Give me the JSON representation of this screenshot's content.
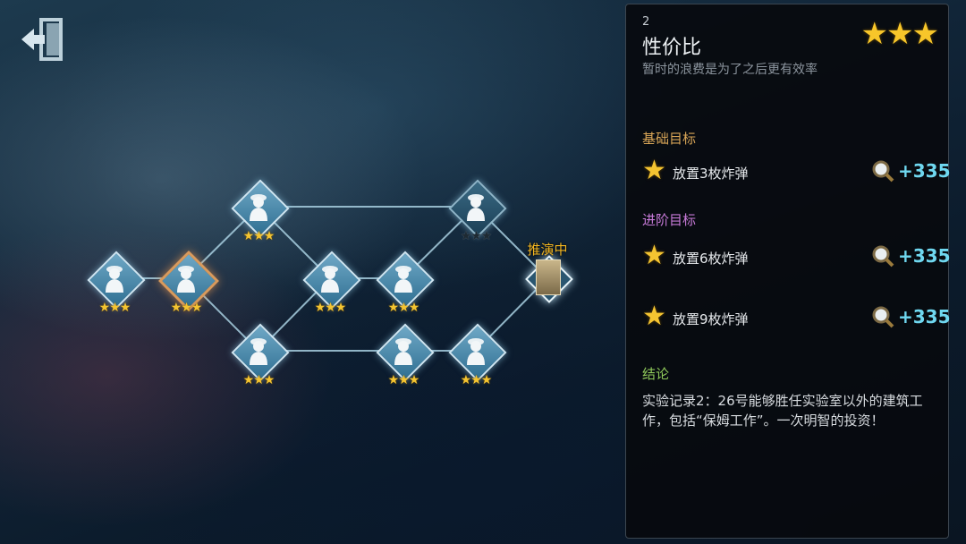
{
  "top_right_faint": "...",
  "current_node": {
    "label": "推演中"
  },
  "map": {
    "nodes": [
      {
        "id": "n1",
        "stars": 3,
        "selected": false,
        "dark": false
      },
      {
        "id": "n2",
        "stars": 3,
        "selected": true,
        "dark": false
      },
      {
        "id": "n3",
        "stars": 3,
        "selected": false,
        "dark": false
      },
      {
        "id": "n4",
        "stars": 3,
        "selected": false,
        "dark": false
      },
      {
        "id": "n5",
        "stars": 3,
        "selected": false,
        "dark": false
      },
      {
        "id": "n6",
        "stars": 3,
        "selected": false,
        "dark": false
      },
      {
        "id": "n7",
        "stars": 3,
        "selected": false,
        "dark": false
      },
      {
        "id": "n8",
        "stars": 3,
        "selected": false,
        "dark": false
      },
      {
        "id": "n9",
        "stars": 0,
        "selected": false,
        "dark": true
      }
    ]
  },
  "panel": {
    "number": "2",
    "title": "性价比",
    "subtitle": "暂时的浪费是为了之后更有效率",
    "rating": 3,
    "basic_heading": "基础目标",
    "advanced_heading": "进阶目标",
    "conclusion_heading": "结论",
    "goals": [
      {
        "text": "放置3枚炸弹",
        "reward": "+335"
      },
      {
        "text": "放置6枚炸弹",
        "reward": "+335"
      },
      {
        "text": "放置9枚炸弹",
        "reward": "+335"
      }
    ],
    "conclusion": "实验记录2：26号能够胜任实验室以外的建筑工作，包括“保姆工作”。一次明智的投资！"
  },
  "colors": {
    "basic_heading": "#d9a657",
    "advanced_heading": "#c77ad8",
    "conclusion_heading": "#8fc95a",
    "reward": "#6fd8f0",
    "star": "#f4c431"
  }
}
